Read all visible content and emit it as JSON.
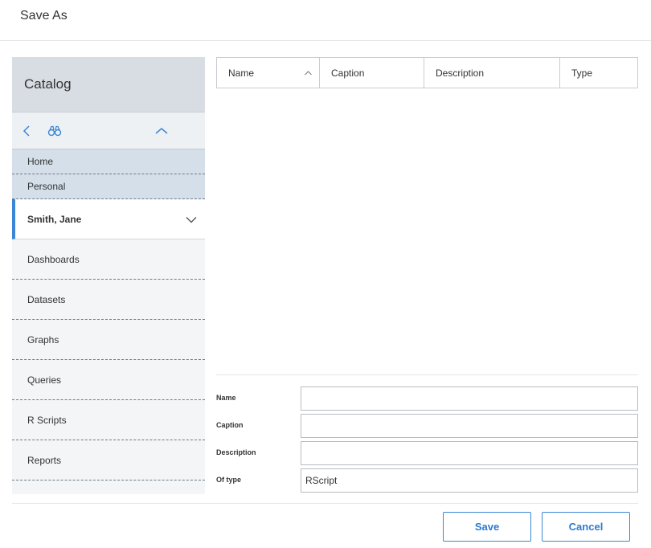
{
  "dialog": {
    "title": "Save As"
  },
  "catalog": {
    "title": "Catalog",
    "breadcrumbs": [
      "Home",
      "Personal"
    ],
    "current_folder": "Smith, Jane",
    "items": [
      "Dashboards",
      "Datasets",
      "Graphs",
      "Queries",
      "R Scripts",
      "Reports"
    ]
  },
  "grid": {
    "columns": [
      "Name",
      "Caption",
      "Description",
      "Type"
    ],
    "sort_column": "Name",
    "sort_direction": "ascending",
    "rows": []
  },
  "form": {
    "name_label": "Name",
    "name_value": "",
    "caption_label": "Caption",
    "caption_value": "",
    "description_label": "Description",
    "description_value": "",
    "type_label": "Of type",
    "type_value": "RScript"
  },
  "buttons": {
    "save": "Save",
    "cancel": "Cancel"
  },
  "colors": {
    "accent": "#3b86d6",
    "catalog_header": "#d8dde3",
    "breadcrumb_bg": "#d4dfea"
  },
  "icons": {
    "back": "chevron-left-icon",
    "find": "binoculars-icon",
    "collapse": "chevron-up-icon",
    "expand": "chevron-down-icon",
    "sort": "sort-ascending-icon"
  }
}
